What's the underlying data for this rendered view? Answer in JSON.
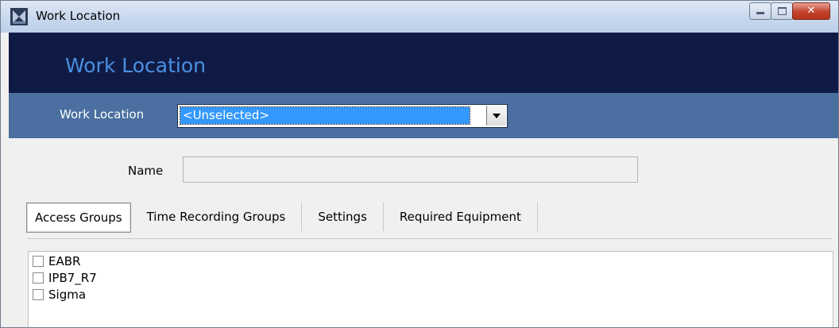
{
  "window": {
    "title": "Work Location"
  },
  "header": {
    "title": "Work Location"
  },
  "selector": {
    "label": "Work Location",
    "value": "<Unselected>"
  },
  "form": {
    "name_label": "Name",
    "name_value": ""
  },
  "tabs": [
    {
      "label": "Access Groups",
      "active": true
    },
    {
      "label": "Time Recording Groups",
      "active": false
    },
    {
      "label": "Settings",
      "active": false
    },
    {
      "label": "Required Equipment",
      "active": false
    }
  ],
  "access_groups": [
    {
      "label": "EABR",
      "checked": false
    },
    {
      "label": "IPB7_R7",
      "checked": false
    },
    {
      "label": "Sigma",
      "checked": false
    }
  ],
  "colors": {
    "header_bg": "#101b45",
    "header_title": "#4a90e2",
    "selector_bg": "#4a6fa0",
    "selection": "#3399ff"
  }
}
